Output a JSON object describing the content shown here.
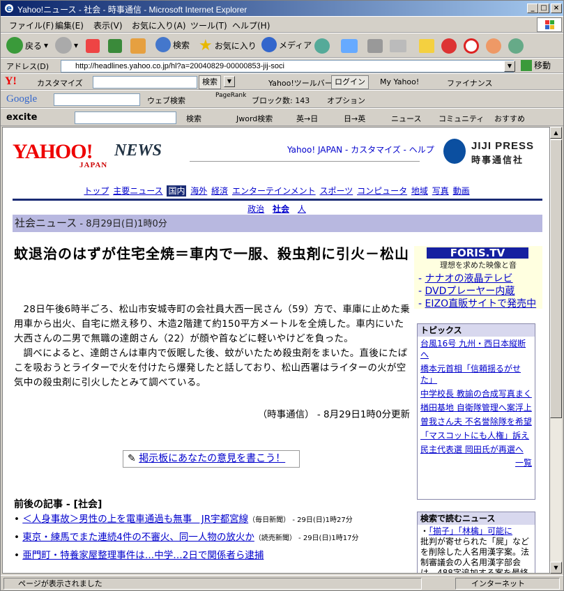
{
  "window": {
    "title": "Yahoo!ニュース - 社会 - 時事通信 - Microsoft Internet Explorer",
    "min": "_",
    "max": "□",
    "close": "×"
  },
  "menu": [
    "ファイル(F)",
    "編集(E)",
    "表示(V)",
    "お気に入り(A)",
    "ツール(T)",
    "ヘルプ(H)"
  ],
  "toolbar": {
    "back": "戻る",
    "search": "検索",
    "favorites": "お気に入り",
    "media": "メディア"
  },
  "address": {
    "label": "アドレス(D)",
    "url": "http://headlines.yahoo.co.jp/hl?a=20040829-00000853-jij-soci",
    "go": "移動"
  },
  "yahoo_toolbar": {
    "logo": "Y!",
    "customize": "カスタマイズ",
    "search_btn": "検索",
    "toolbar_label": "Yahoo!ツールバー:",
    "login": "ログイン",
    "my_yahoo": "My Yahoo!",
    "finance": "ファイナンス"
  },
  "google_toolbar": {
    "logo": "Google",
    "web_search": "ウェブ検索",
    "pagerank": "PageRank",
    "blocked": "ブロック数: 143",
    "options": "オプション"
  },
  "excite_toolbar": {
    "logo": "excite",
    "search": "検索",
    "jword": "Jword検索",
    "en_ja": "英→日",
    "ja_en": "日→英",
    "news": "ニュース",
    "community": "コミュニティ",
    "recommend": "おすすめ"
  },
  "header": {
    "yahoo": "YAHOO!",
    "japan": "JAPAN",
    "news": "NEWS",
    "links": "Yahoo! JAPAN - カスタマイズ - ヘルプ",
    "jiji_en": "JIJI PRESS",
    "jiji_jp": "時事通信社"
  },
  "nav": {
    "items": [
      "トップ",
      "主要ニュース",
      "国内",
      "海外",
      "経済",
      "エンターテインメント",
      "スポーツ",
      "コンピュータ",
      "地域",
      "写真",
      "動画"
    ],
    "sub": [
      "政治",
      "社会",
      "人"
    ]
  },
  "category": {
    "name": "社会ニュース",
    "date": " - 8月29日(日)1時0分"
  },
  "article": {
    "headline": "蚊退治のはずが住宅全焼＝車内で一服、殺虫剤に引火－松山",
    "p1": "28日午後6時半ごろ、松山市安城寺町の会社員大西一民さん（59）方で、車庫に止めた乗用車から出火、自宅に燃え移り、木造2階建て約150平方メートルを全焼した。車内にいた大西さんの二男で無職の達朗さん（22）が顔や首などに軽いやけどを負った。",
    "p2": "調べによると、達朗さんは車内で仮眠した後、蚊がいたため殺虫剤をまいた。直後にたばこを吸おうとライターで火を付けたら爆発したと話しており、松山西署はライターの火が空気中の殺虫剤に引火したとみて調べている。",
    "credit": "（時事通信） - 8月29日1時0分更新",
    "bbs": "掲示板にあなたの意見を書こう！"
  },
  "related": {
    "heading": "前後の記事 - [社会]",
    "items": [
      {
        "title": "＜人身事故＞男性の上を電車通過も無事　JR宇都宮線",
        "src": "（毎日新聞）",
        "time": " - 29日(日)1時27分"
      },
      {
        "title": "東京・練馬でまた連続4件の不審火、同一人物の放火か",
        "src": "（読売新聞）",
        "time": " - 29日(日)1時17分"
      },
      {
        "title": "亜門町・特養家屋整理事件は…中学…2日で関係者ら逮捕",
        "src": "",
        "time": ""
      }
    ]
  },
  "ad": {
    "title": "FORIS.TV",
    "sub": "理想を求めた映像と音",
    "links": [
      "ナナオの液晶テレビ",
      "DVDプレーヤー内蔵",
      "EIZO直販サイトで発売中"
    ]
  },
  "topics": {
    "heading": "トピックス",
    "items": [
      "台風16号 九州・西日本縦断へ",
      "橋本元首相「信頼揺るがせた」",
      "中学校長 教諭の合成写真まく",
      "楢田基地 自衛隊管理へ案浮上",
      "曽我さん夫 不名誉除隊を希望",
      "「マスコットにも人権」訴え",
      "民主代表選 岡田氏が再選へ"
    ],
    "more": "一覧"
  },
  "search_news": {
    "heading": "検索で読むニュース",
    "link": "「揃子」「林檎」可能に",
    "body": "批判が寄せられた「屍」などを削除した人名用漢字案。法制審議会の人名用漢字部会は、488字追加する案を最終"
  },
  "status": {
    "left": "ページが表示されました",
    "zone": "インターネット"
  }
}
